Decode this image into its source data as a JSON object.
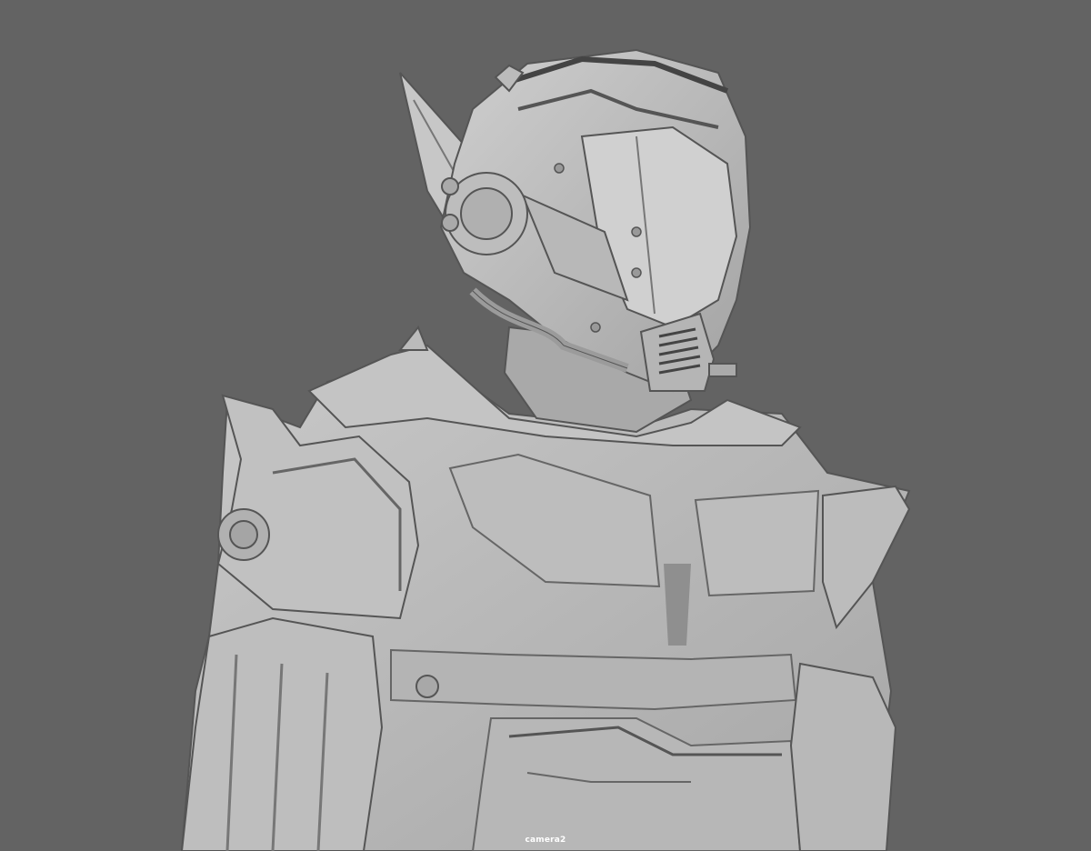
{
  "viewport": {
    "camera_label": "camera2",
    "background_color": "#636363",
    "model_base_color": "#b9b9b9",
    "model_shadow_color": "#6f6f6f"
  }
}
